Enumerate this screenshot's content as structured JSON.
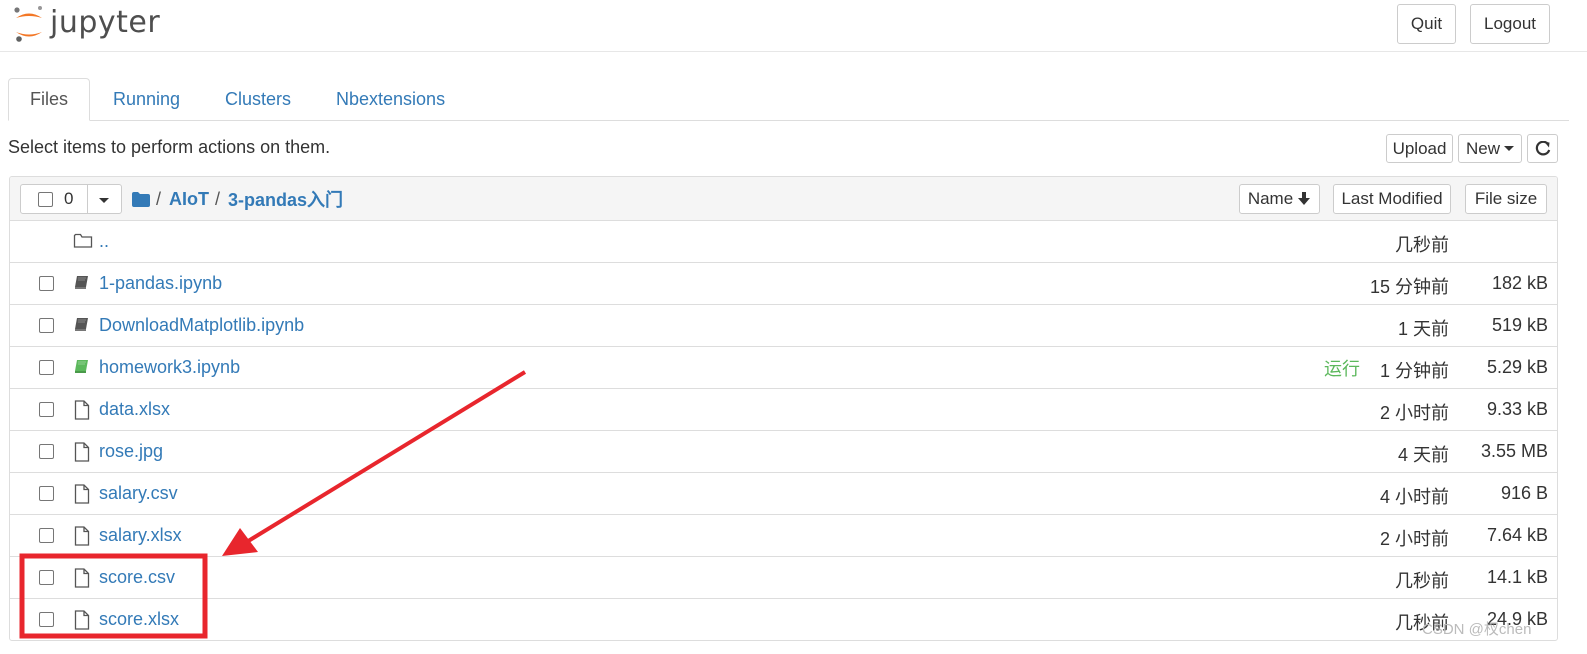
{
  "header": {
    "logo_text": "jupyter",
    "quit_label": "Quit",
    "logout_label": "Logout"
  },
  "tabs": [
    {
      "label": "Files",
      "active": true
    },
    {
      "label": "Running",
      "active": false
    },
    {
      "label": "Clusters",
      "active": false
    },
    {
      "label": "Nbextensions",
      "active": false
    }
  ],
  "toolbar": {
    "hint": "Select items to perform actions on them.",
    "upload_label": "Upload",
    "new_label": "New",
    "refresh_icon": "refresh-icon"
  },
  "list_header": {
    "selected_count": "0",
    "breadcrumb": [
      "AIoT",
      "3-pandas入门"
    ],
    "root_icon": "folder-icon",
    "sort_name_label": "Name",
    "sort_modified_label": "Last Modified",
    "sort_size_label": "File size"
  },
  "rows": [
    {
      "name": "..",
      "type": "folder",
      "modified": "几秒前",
      "size": "",
      "running": "",
      "checkbox": false
    },
    {
      "name": "1-pandas.ipynb",
      "type": "notebook",
      "modified": "15 分钟前",
      "size": "182 kB",
      "running": "",
      "checkbox": true
    },
    {
      "name": "DownloadMatplotlib.ipynb",
      "type": "notebook",
      "modified": "1 天前",
      "size": "519 kB",
      "running": "",
      "checkbox": true
    },
    {
      "name": "homework3.ipynb",
      "type": "notebook-running",
      "modified": "1 分钟前",
      "size": "5.29 kB",
      "running": "运行",
      "checkbox": true
    },
    {
      "name": "data.xlsx",
      "type": "file",
      "modified": "2 小时前",
      "size": "9.33 kB",
      "running": "",
      "checkbox": true
    },
    {
      "name": "rose.jpg",
      "type": "file",
      "modified": "4 天前",
      "size": "3.55 MB",
      "running": "",
      "checkbox": true
    },
    {
      "name": "salary.csv",
      "type": "file",
      "modified": "4 小时前",
      "size": "916 B",
      "running": "",
      "checkbox": true
    },
    {
      "name": "salary.xlsx",
      "type": "file",
      "modified": "2 小时前",
      "size": "7.64 kB",
      "running": "",
      "checkbox": true
    },
    {
      "name": "score.csv",
      "type": "file",
      "modified": "几秒前",
      "size": "14.1 kB",
      "running": "",
      "checkbox": true
    },
    {
      "name": "score.xlsx",
      "type": "file",
      "modified": "几秒前",
      "size": "24.9 kB",
      "running": "",
      "checkbox": true
    }
  ],
  "annotation": {
    "color": "#e8262d",
    "watermark": "CSDN @杈chen"
  },
  "colors": {
    "link": "#337ab7",
    "running": "#5cb85c",
    "logo_orange": "#f37726"
  }
}
